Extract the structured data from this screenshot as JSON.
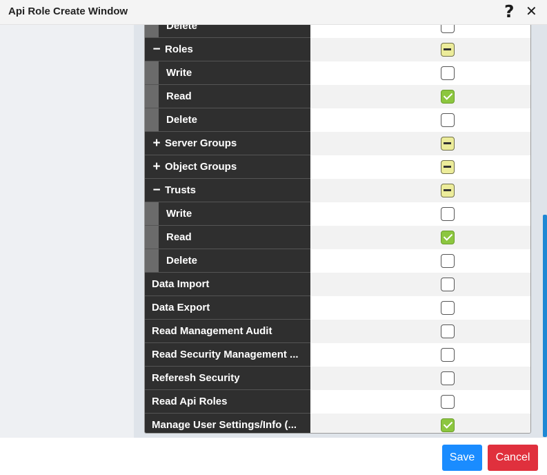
{
  "window": {
    "title": "Api Role Create Window",
    "help_icon": "?",
    "close_icon": "✕"
  },
  "rows": [
    {
      "label": "Delete",
      "level": "child",
      "toggle": "",
      "state": "unchecked"
    },
    {
      "label": "Roles",
      "level": "group",
      "toggle": "−",
      "state": "partial"
    },
    {
      "label": "Write",
      "level": "child",
      "toggle": "",
      "state": "unchecked"
    },
    {
      "label": "Read",
      "level": "child",
      "toggle": "",
      "state": "checked"
    },
    {
      "label": "Delete",
      "level": "child",
      "toggle": "",
      "state": "unchecked"
    },
    {
      "label": "Server Groups",
      "level": "group",
      "toggle": "+",
      "state": "partial"
    },
    {
      "label": "Object Groups",
      "level": "group",
      "toggle": "+",
      "state": "partial"
    },
    {
      "label": "Trusts",
      "level": "group",
      "toggle": "−",
      "state": "partial"
    },
    {
      "label": "Write",
      "level": "child",
      "toggle": "",
      "state": "unchecked"
    },
    {
      "label": "Read",
      "level": "child",
      "toggle": "",
      "state": "checked"
    },
    {
      "label": "Delete",
      "level": "child",
      "toggle": "",
      "state": "unchecked"
    },
    {
      "label": "Data Import",
      "level": "top",
      "toggle": "",
      "state": "unchecked"
    },
    {
      "label": "Data Export",
      "level": "top",
      "toggle": "",
      "state": "unchecked"
    },
    {
      "label": "Read Management Audit",
      "level": "top",
      "toggle": "",
      "state": "unchecked"
    },
    {
      "label": "Read Security Management ...",
      "level": "top",
      "toggle": "",
      "state": "unchecked"
    },
    {
      "label": "Referesh Security",
      "level": "top",
      "toggle": "",
      "state": "unchecked"
    },
    {
      "label": "Read Api Roles",
      "level": "top",
      "toggle": "",
      "state": "unchecked"
    },
    {
      "label": "Manage User Settings/Info (...",
      "level": "top",
      "toggle": "",
      "state": "checked"
    }
  ],
  "footer": {
    "save_label": "Save",
    "cancel_label": "Cancel"
  },
  "colors": {
    "accent": "#1a8cff",
    "danger": "#e0303d",
    "checked": "#8cc63f",
    "partial": "#ecec9a"
  }
}
